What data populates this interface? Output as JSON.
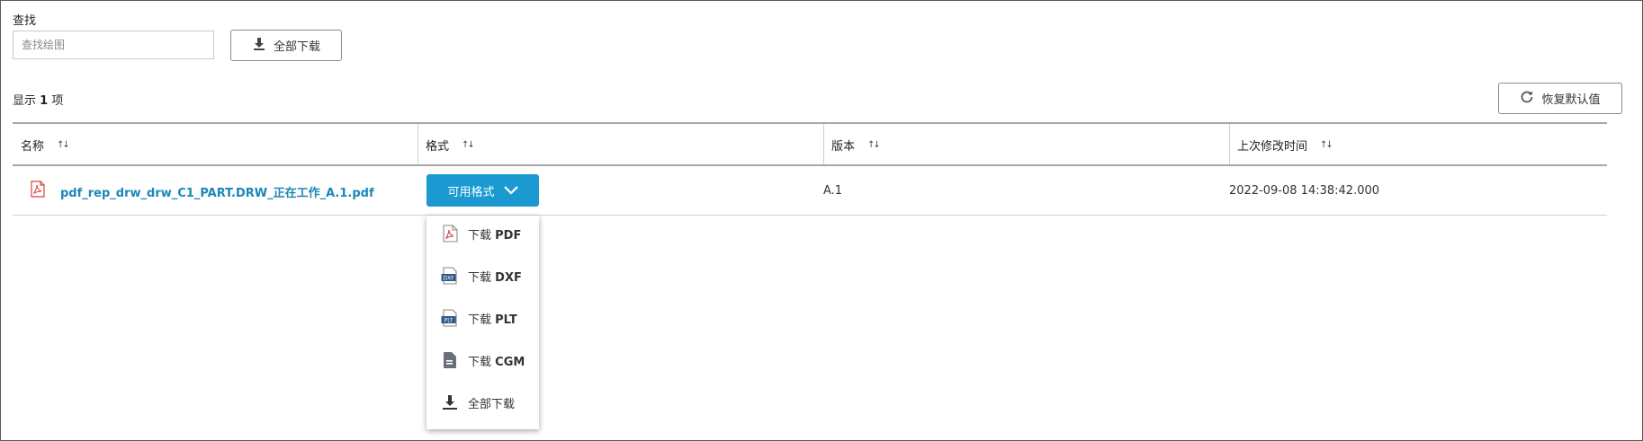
{
  "search": {
    "label": "查找",
    "placeholder": "查找绘图"
  },
  "toolbar": {
    "download_all_label": "全部下载",
    "reset_label": "恢复默认值"
  },
  "results": {
    "prefix": "显示",
    "count": "1",
    "suffix": "项"
  },
  "table": {
    "columns": [
      {
        "label": "名称"
      },
      {
        "label": "格式"
      },
      {
        "label": "版本"
      },
      {
        "label": "上次修改时间"
      }
    ],
    "rows": [
      {
        "name": "pdf_rep_drw_drw_C1_PART.DRW_正在工作_A.1.pdf",
        "formats_button": "可用格式",
        "version": "A.1",
        "modified": "2022-09-08 14:38:42.000"
      }
    ]
  },
  "format_menu": {
    "items": [
      {
        "prefix": "下载",
        "format": "PDF",
        "icon": "pdf-icon"
      },
      {
        "prefix": "下载",
        "format": "DXF",
        "icon": "dxf-icon"
      },
      {
        "prefix": "下载",
        "format": "PLT",
        "icon": "plt-icon"
      },
      {
        "prefix": "下载",
        "format": "CGM",
        "icon": "cgm-icon"
      },
      {
        "prefix": "全部下载",
        "format": "",
        "icon": "download-icon"
      }
    ]
  },
  "colors": {
    "accent": "#1a9ad0",
    "link": "#1b87b8",
    "pdf_red": "#d8413b"
  }
}
